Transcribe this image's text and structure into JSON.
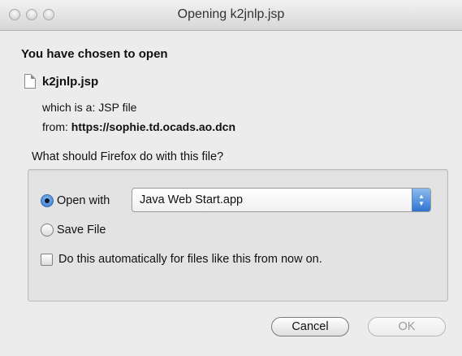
{
  "window": {
    "title": "Opening k2jnlp.jsp"
  },
  "dialog": {
    "heading": "You have chosen to open",
    "file_name": "k2jnlp.jsp",
    "type_label": "which is a: ",
    "type_value": "JSP file",
    "from_label": "from: ",
    "from_value": "https://sophie.td.ocads.ao.dcn",
    "question": "What should Firefox do with this file?",
    "open_with_label": "Open with",
    "open_with_app": "Java Web Start.app",
    "save_file_label": "Save File",
    "auto_label": "Do this automatically for files like this from now on.",
    "selected_option": "open_with",
    "auto_checked": false
  },
  "buttons": {
    "cancel": "Cancel",
    "ok": "OK"
  },
  "icons": {
    "file": "file-icon",
    "close": "close-window-icon",
    "minimize": "minimize-window-icon",
    "zoom": "zoom-window-icon",
    "select_arrows": "up-down-arrows-icon"
  },
  "colors": {
    "accent": "#2f73d0"
  }
}
